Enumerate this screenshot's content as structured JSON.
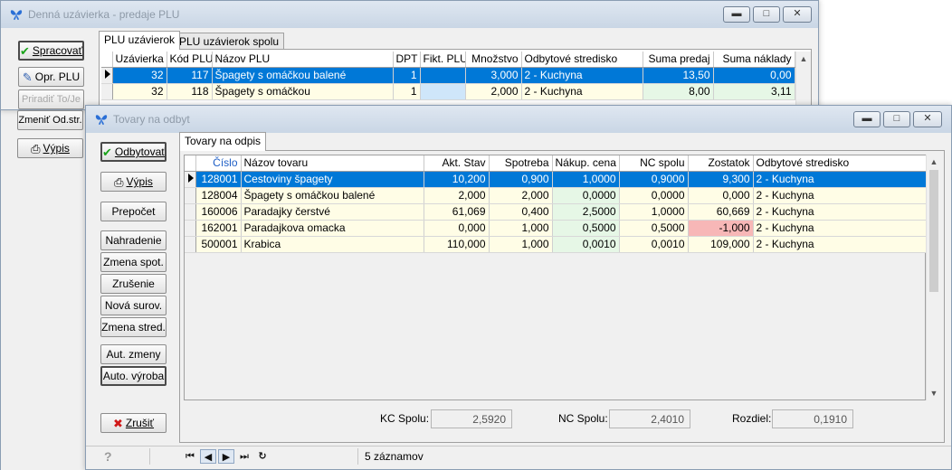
{
  "back_window": {
    "title": "Denná uzávierka - predaje PLU",
    "tabs": [
      {
        "label": "PLU uzávierok",
        "active": true
      },
      {
        "label": "PLU uzávierok spolu",
        "active": false
      }
    ],
    "buttons": {
      "spracovat": "Spracovať",
      "opr_plu": "Opr. PLU",
      "priradit": "Priradiť To/Je",
      "zmenit": "Zmeniť Od.str.",
      "vypis": "Výpis"
    },
    "grid": {
      "columns": [
        "Uzávierka",
        "Kód PLU",
        "Názov PLU",
        "DPT",
        "Fikt. PLU",
        "Množstvo",
        "Odbytové stredisko",
        "Suma predaj",
        "Suma náklady"
      ],
      "rows": [
        {
          "uzavierka": "32",
          "kod": "117",
          "nazov": "Špagety s omáčkou balené",
          "dpt": "1",
          "fikt": "",
          "mnozstvo": "3,000",
          "stredisko": "2 - Kuchyna",
          "predaj": "13,50",
          "naklady": "0,00",
          "selected": true
        },
        {
          "uzavierka": "32",
          "kod": "118",
          "nazov": "Špagety s omáčkou",
          "dpt": "1",
          "fikt": "",
          "mnozstvo": "2,000",
          "stredisko": "2 - Kuchyna",
          "predaj": "8,00",
          "naklady": "3,11",
          "selected": false
        }
      ]
    }
  },
  "front_window": {
    "title": "Tovary na odbyt",
    "tab": "Tovary na odpis",
    "buttons": {
      "odbytovat": "Odbytovať",
      "vypis": "Výpis",
      "prepocet": "Prepočet",
      "nahradenie": "Nahradenie",
      "zmena_spot": "Zmena spot.",
      "zrusenie": "Zrušenie",
      "nova_surov": "Nová surov.",
      "zmena_stred": "Zmena stred.",
      "aut_zmeny": "Aut. zmeny",
      "auto_vyroba": "Auto. výroba",
      "zrusit": "Zrušiť"
    },
    "grid": {
      "columns": [
        "Číslo",
        "Názov tovaru",
        "Akt. Stav",
        "Spotreba",
        "Nákup. cena",
        "NC spolu",
        "Zostatok",
        "Odbytové stredisko"
      ],
      "rows": [
        {
          "cislo": "128001",
          "nazov": "Cestoviny špagety",
          "stav": "10,200",
          "spotreba": "0,900",
          "cena": "1,0000",
          "nc": "0,9000",
          "zostatok": "9,300",
          "stredisko": "2 - Kuchyna",
          "selected": true,
          "negative": false
        },
        {
          "cislo": "128004",
          "nazov": "Špagety s omáčkou balené",
          "stav": "2,000",
          "spotreba": "2,000",
          "cena": "0,0000",
          "nc": "0,0000",
          "zostatok": "0,000",
          "stredisko": "2 - Kuchyna",
          "selected": false,
          "negative": false
        },
        {
          "cislo": "160006",
          "nazov": "Paradajky čerstvé",
          "stav": "61,069",
          "spotreba": "0,400",
          "cena": "2,5000",
          "nc": "1,0000",
          "zostatok": "60,669",
          "stredisko": "2 - Kuchyna",
          "selected": false,
          "negative": false
        },
        {
          "cislo": "162001",
          "nazov": "Paradajkova omacka",
          "stav": "0,000",
          "spotreba": "1,000",
          "cena": "0,5000",
          "nc": "0,5000",
          "zostatok": "-1,000",
          "stredisko": "2 - Kuchyna",
          "selected": false,
          "negative": true
        },
        {
          "cislo": "500001",
          "nazov": "Krabica",
          "stav": "110,000",
          "spotreba": "1,000",
          "cena": "0,0010",
          "nc": "0,0010",
          "zostatok": "109,000",
          "stredisko": "2 - Kuchyna",
          "selected": false,
          "negative": false
        }
      ]
    },
    "totals": {
      "kc_label": "KC Spolu:",
      "kc_value": "2,5920",
      "nc_label": "NC Spolu:",
      "nc_value": "2,4010",
      "rozdiel_label": "Rozdiel:",
      "rozdiel_value": "0,1910"
    },
    "status": {
      "record_count": "5 záznamov"
    }
  },
  "colors": {
    "selection": "#0078d7",
    "row_yellow": "#fffde6",
    "row_green": "#e6f7e6",
    "negative": "#f7b7b7"
  }
}
